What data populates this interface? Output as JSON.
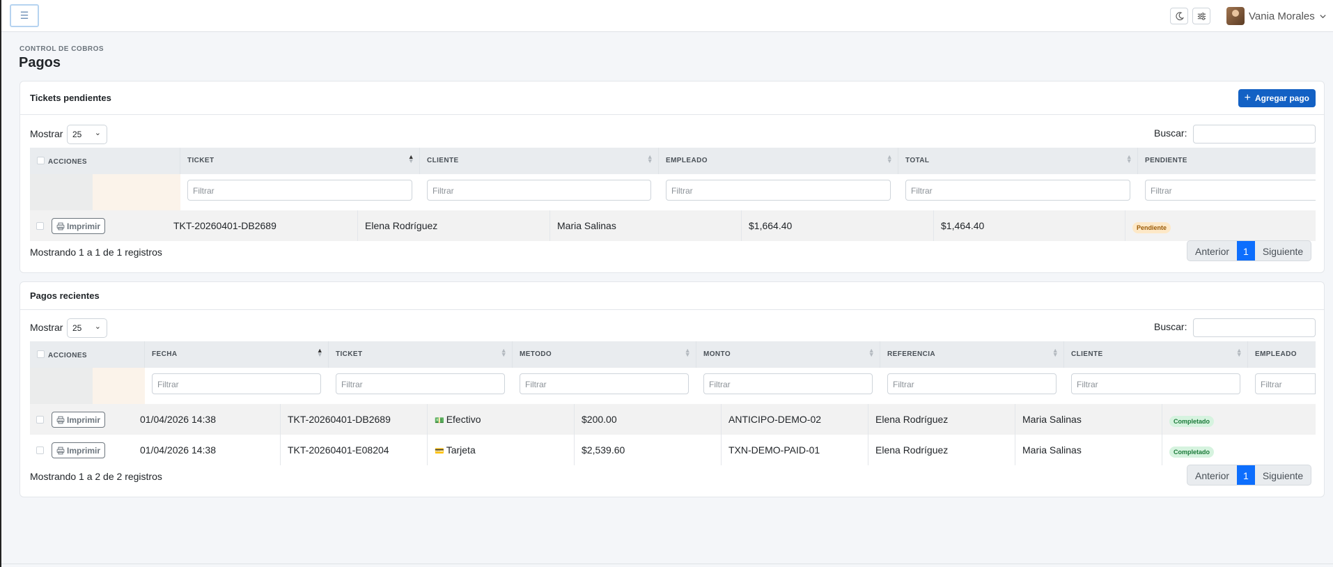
{
  "topbar": {
    "menu_icon": "hamburger-icon",
    "theme_icon": "moon-icon",
    "settings_icon": "sliders-icon",
    "user_name": "Vania Morales"
  },
  "header": {
    "eyebrow": "CONTROL DE COBROS",
    "title": "Pagos"
  },
  "pending": {
    "title": "Tickets pendientes",
    "add_label": "Agregar pago",
    "show_label": "Mostrar",
    "page_size": "25",
    "search_label": "Buscar:",
    "columns": [
      "ACCIONES",
      "TICKET",
      "CLIENTE",
      "EMPLEADO",
      "TOTAL",
      "PENDIENTE"
    ],
    "filter_placeholder": "Filtrar",
    "rows": [
      {
        "action": "Imprimir",
        "ticket": "TKT-20260401-DB2689",
        "cliente": "Elena Rodríguez",
        "empleado": "Maria Salinas",
        "total": "$1,664.40",
        "pendiente": "$1,464.40",
        "estado": "Pendiente"
      }
    ],
    "summary": "Mostrando 1 a 1 de 1 registros",
    "pager": {
      "prev": "Anterior",
      "page": "1",
      "next": "Siguiente"
    }
  },
  "recent": {
    "title": "Pagos recientes",
    "show_label": "Mostrar",
    "page_size": "25",
    "search_label": "Buscar:",
    "columns": [
      "ACCIONES",
      "FECHA",
      "TICKET",
      "METODO",
      "MONTO",
      "REFERENCIA",
      "CLIENTE",
      "EMPLEADO"
    ],
    "filter_placeholder": "Filtrar",
    "rows": [
      {
        "action": "Imprimir",
        "fecha": "01/04/2026 14:38",
        "ticket": "TKT-20260401-DB2689",
        "metodo_icon": "cash-icon",
        "metodo": "Efectivo",
        "monto": "$200.00",
        "referencia": "ANTICIPO-DEMO-02",
        "cliente": "Elena Rodríguez",
        "empleado": "Maria Salinas",
        "estado": "Completado"
      },
      {
        "action": "Imprimir",
        "fecha": "01/04/2026 14:38",
        "ticket": "TKT-20260401-E08204",
        "metodo_icon": "card-icon",
        "metodo": "Tarjeta",
        "monto": "$2,539.60",
        "referencia": "TXN-DEMO-PAID-01",
        "cliente": "Elena Rodríguez",
        "empleado": "Maria Salinas",
        "estado": "Completado"
      }
    ],
    "summary": "Mostrando 1 a 2 de 2 registros",
    "pager": {
      "prev": "Anterior",
      "page": "1",
      "next": "Siguiente"
    }
  },
  "colors": {
    "primary": "#1361c4",
    "page_active": "#0d6efd",
    "warning_bg": "#fde8c7",
    "success_bg": "#d6f3df"
  }
}
